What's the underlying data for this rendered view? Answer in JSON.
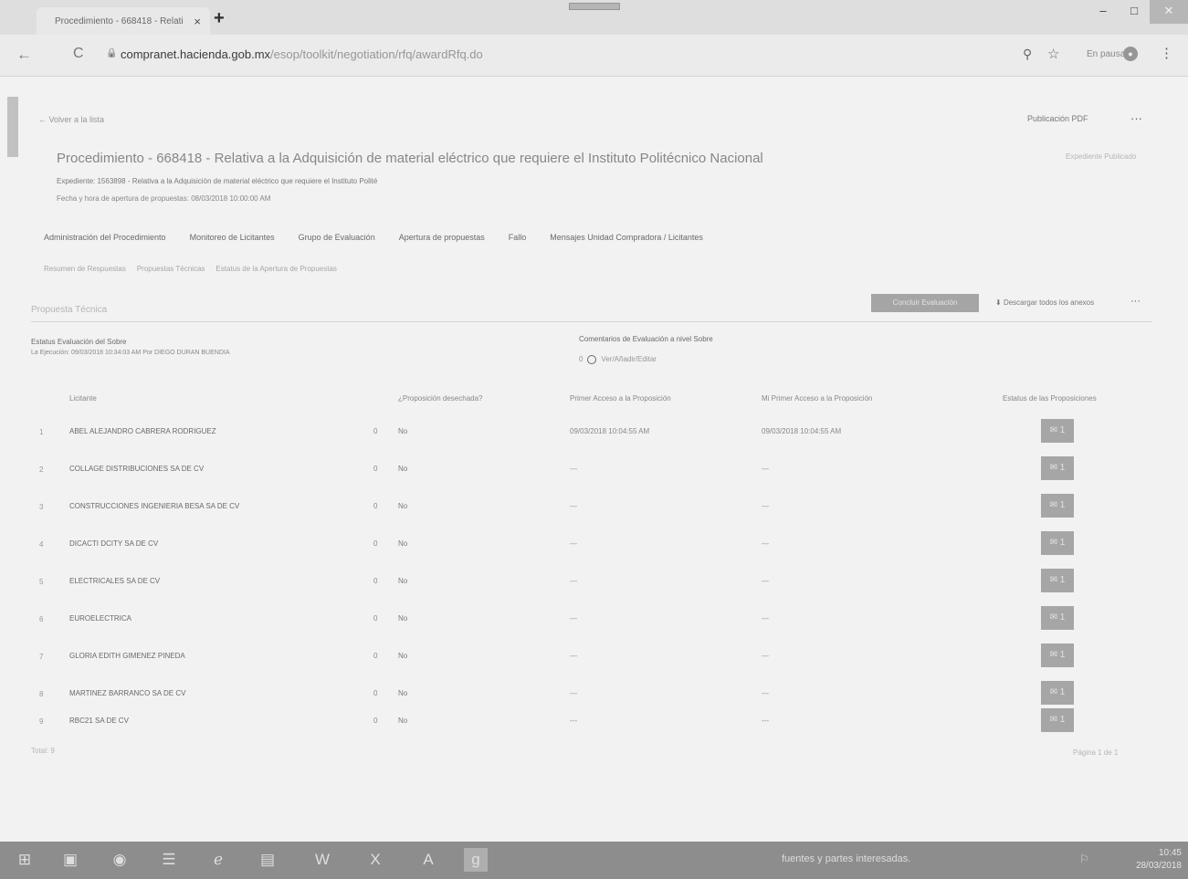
{
  "browser": {
    "tab_title": "Procedimiento - 668418 - Relati",
    "tab_close": "×",
    "new_tab": "+",
    "url_host": "compranet.hacienda.gob.mx",
    "url_path": "/esop/toolkit/negotiation/rfq/awardRfq.do",
    "pause_label": "En pausa",
    "nav_back": "←",
    "nav_reload": "C",
    "lock": "🔒",
    "zoom": "⚲",
    "star": "☆",
    "menu": "⋮",
    "min": "–",
    "max": "□",
    "close": "✕"
  },
  "header": {
    "back_link": "← Volver a la lista",
    "publish_pdf": "Publicación PDF",
    "more": "···",
    "title": "Procedimiento - 668418 - Relativa a la Adquisición de material eléctrico que requiere el Instituto Politécnico Nacional",
    "right_faint": "Expediente Publicado",
    "expediente": "Expediente: 1563898 - Relativa a la Adquisición de material eléctrico que requiere el Instituto Polité",
    "fecha_apertura": "Fecha y hora de apertura de propuestas: 08/03/2018 10:00:00 AM"
  },
  "tabs_primary": [
    "Administración del Procedimiento",
    "Monitoreo de Licitantes",
    "Grupo de Evaluación",
    "Apertura de propuestas",
    "Fallo",
    "Mensajes Unidad Compradora / Licitantes"
  ],
  "tabs_secondary": [
    "Resumen de Respuestas",
    "Propuestas Técnicas",
    "Estatus de la Apertura de Propuestas"
  ],
  "section": {
    "title": "Propuesta Técnica",
    "primary_button": "Concluir Evaluación",
    "download": "Descargar todos los anexos",
    "more": "···"
  },
  "status": {
    "label": "Estatus Evaluación del Sobre",
    "value": "La Ejecución: 09/03/2018 10:34:03 AM Por DIEGO DURAN BUENDIA",
    "comments_label": "Comentarios de Evaluación a nivel Sobre",
    "comments_count": "0",
    "comments_text": "Ver/Añadir/Editar"
  },
  "table": {
    "headers": {
      "licitante": "Licitante",
      "desechada": "¿Proposición desechada?",
      "primer_acceso": "Primer Acceso a la Proposición",
      "mi_primer_acceso": "Mi Primer Acceso a la Proposición",
      "estatus": "Estatus de las Proposiciones"
    },
    "rows": [
      {
        "num": "1",
        "licitante": "ABEL ALEJANDRO CABRERA RODRIGUEZ",
        "zero": "0",
        "desechada": "No",
        "primer": "09/03/2018 10:04:55 AM",
        "mi_primer": "09/03/2018 10:04:55 AM",
        "estatus": "✉ 1"
      },
      {
        "num": "2",
        "licitante": "COLLAGE DISTRIBUCIONES SA DE CV",
        "zero": "0",
        "desechada": "No",
        "primer": "---",
        "mi_primer": "---",
        "estatus": "✉ 1"
      },
      {
        "num": "3",
        "licitante": "CONSTRUCCIONES INGENIERIA BESA SA DE CV",
        "zero": "0",
        "desechada": "No",
        "primer": "---",
        "mi_primer": "---",
        "estatus": "✉ 1"
      },
      {
        "num": "4",
        "licitante": "DICACTI DCITY SA DE CV",
        "zero": "0",
        "desechada": "No",
        "primer": "---",
        "mi_primer": "---",
        "estatus": "✉ 1"
      },
      {
        "num": "5",
        "licitante": "ELECTRICALES SA DE CV",
        "zero": "0",
        "desechada": "No",
        "primer": "---",
        "mi_primer": "---",
        "estatus": "✉ 1"
      },
      {
        "num": "6",
        "licitante": "EUROELECTRICA",
        "zero": "0",
        "desechada": "No",
        "primer": "---",
        "mi_primer": "---",
        "estatus": "✉ 1"
      },
      {
        "num": "7",
        "licitante": "GLORIA EDITH GIMENEZ PINEDA",
        "zero": "0",
        "desechada": "No",
        "primer": "---",
        "mi_primer": "---",
        "estatus": "✉ 1"
      },
      {
        "num": "8",
        "licitante": "MARTINEZ BARRANCO SA DE CV",
        "zero": "0",
        "desechada": "No",
        "primer": "---",
        "mi_primer": "---",
        "estatus": "✉ 1"
      },
      {
        "num": "9",
        "licitante": "RBC21 SA DE CV",
        "zero": "0",
        "desechada": "No",
        "primer": "---",
        "mi_primer": "---",
        "estatus": "✉ 1"
      }
    ],
    "total": "Total: 9",
    "pages": "Página 1 de 1"
  },
  "taskbar": {
    "tray_text": "fuentes y partes interesadas.",
    "time": "10:45",
    "date": "28/03/2018",
    "icons": [
      "⊞",
      "▣",
      "◉",
      "☰",
      "ℯ",
      "▤",
      "W",
      "X",
      "A",
      "g"
    ]
  }
}
